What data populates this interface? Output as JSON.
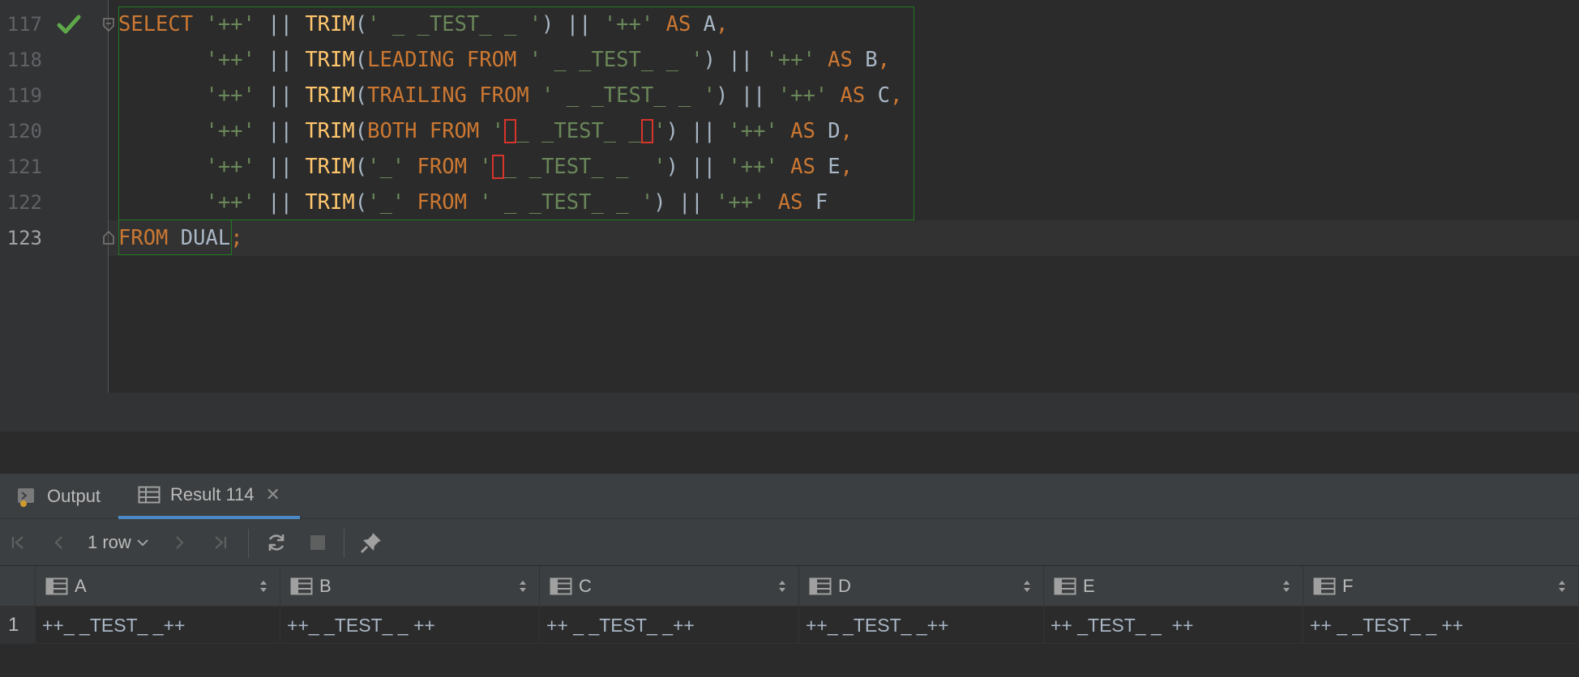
{
  "editor": {
    "line_numbers": [
      "117",
      "118",
      "119",
      "120",
      "121",
      "122",
      "123"
    ],
    "lines": [
      [
        {
          "t": "SELECT",
          "c": "kw"
        },
        {
          "t": " ",
          "c": ""
        },
        {
          "t": "'++'",
          "c": "str"
        },
        {
          "t": " || ",
          "c": ""
        },
        {
          "t": "TRIM",
          "c": "fn"
        },
        {
          "t": "(",
          "c": ""
        },
        {
          "t": "' _ _TEST_ _ '",
          "c": "str"
        },
        {
          "t": ") || ",
          "c": ""
        },
        {
          "t": "'++'",
          "c": "str"
        },
        {
          "t": " ",
          "c": ""
        },
        {
          "t": "AS",
          "c": "kw"
        },
        {
          "t": " A",
          "c": ""
        },
        {
          "t": ",",
          "c": "kw"
        }
      ],
      [
        {
          "t": "       ",
          "c": ""
        },
        {
          "t": "'++'",
          "c": "str"
        },
        {
          "t": " || ",
          "c": ""
        },
        {
          "t": "TRIM",
          "c": "fn"
        },
        {
          "t": "(",
          "c": ""
        },
        {
          "t": "LEADING FROM",
          "c": "kw"
        },
        {
          "t": " ",
          "c": ""
        },
        {
          "t": "' _ _TEST_ _ '",
          "c": "str"
        },
        {
          "t": ") || ",
          "c": ""
        },
        {
          "t": "'++'",
          "c": "str"
        },
        {
          "t": " ",
          "c": ""
        },
        {
          "t": "AS",
          "c": "kw"
        },
        {
          "t": " B",
          "c": ""
        },
        {
          "t": ",",
          "c": "kw"
        }
      ],
      [
        {
          "t": "       ",
          "c": ""
        },
        {
          "t": "'++'",
          "c": "str"
        },
        {
          "t": " || ",
          "c": ""
        },
        {
          "t": "TRIM",
          "c": "fn"
        },
        {
          "t": "(",
          "c": ""
        },
        {
          "t": "TRAILING FROM",
          "c": "kw"
        },
        {
          "t": " ",
          "c": ""
        },
        {
          "t": "' _ _TEST_ _ '",
          "c": "str"
        },
        {
          "t": ") || ",
          "c": ""
        },
        {
          "t": "'++'",
          "c": "str"
        },
        {
          "t": " ",
          "c": ""
        },
        {
          "t": "AS",
          "c": "kw"
        },
        {
          "t": " C",
          "c": ""
        },
        {
          "t": ",",
          "c": "kw"
        }
      ],
      [
        {
          "t": "       ",
          "c": ""
        },
        {
          "t": "'++'",
          "c": "str"
        },
        {
          "t": " || ",
          "c": ""
        },
        {
          "t": "TRIM",
          "c": "fn"
        },
        {
          "t": "(",
          "c": ""
        },
        {
          "t": "BOTH FROM",
          "c": "kw"
        },
        {
          "t": " ",
          "c": ""
        },
        {
          "t": "'",
          "c": "str"
        },
        {
          "t": " ",
          "c": "str hl"
        },
        {
          "t": "_ _TEST_ _",
          "c": "str"
        },
        {
          "t": " ",
          "c": "str hl"
        },
        {
          "t": "'",
          "c": "str"
        },
        {
          "t": ") || ",
          "c": ""
        },
        {
          "t": "'++'",
          "c": "str"
        },
        {
          "t": " ",
          "c": ""
        },
        {
          "t": "AS",
          "c": "kw"
        },
        {
          "t": " D",
          "c": ""
        },
        {
          "t": ",",
          "c": "kw"
        }
      ],
      [
        {
          "t": "       ",
          "c": ""
        },
        {
          "t": "'++'",
          "c": "str"
        },
        {
          "t": " || ",
          "c": ""
        },
        {
          "t": "TRIM",
          "c": "fn"
        },
        {
          "t": "(",
          "c": ""
        },
        {
          "t": "'_'",
          "c": "str"
        },
        {
          "t": " ",
          "c": ""
        },
        {
          "t": "FROM",
          "c": "kw"
        },
        {
          "t": " ",
          "c": ""
        },
        {
          "t": "'",
          "c": "str"
        },
        {
          "t": " ",
          "c": "str hl"
        },
        {
          "t": "_ _TEST_ _  '",
          "c": "str"
        },
        {
          "t": ") || ",
          "c": ""
        },
        {
          "t": "'++'",
          "c": "str"
        },
        {
          "t": " ",
          "c": ""
        },
        {
          "t": "AS",
          "c": "kw"
        },
        {
          "t": " E",
          "c": ""
        },
        {
          "t": ",",
          "c": "kw"
        }
      ],
      [
        {
          "t": "       ",
          "c": ""
        },
        {
          "t": "'++'",
          "c": "str"
        },
        {
          "t": " || ",
          "c": ""
        },
        {
          "t": "TRIM",
          "c": "fn"
        },
        {
          "t": "(",
          "c": ""
        },
        {
          "t": "'_'",
          "c": "str"
        },
        {
          "t": " ",
          "c": ""
        },
        {
          "t": "FROM",
          "c": "kw"
        },
        {
          "t": " ",
          "c": ""
        },
        {
          "t": "' _ _TEST_ _ '",
          "c": "str"
        },
        {
          "t": ") || ",
          "c": ""
        },
        {
          "t": "'++'",
          "c": "str"
        },
        {
          "t": " ",
          "c": ""
        },
        {
          "t": "AS",
          "c": "kw"
        },
        {
          "t": " F",
          "c": ""
        }
      ],
      [
        {
          "t": "FROM",
          "c": "kw"
        },
        {
          "t": " DUAL",
          "c": ""
        },
        {
          "t": ";",
          "c": "kw"
        }
      ]
    ]
  },
  "tool_window": {
    "tab_output": "Output",
    "tab_result": "Result 114",
    "tab_close": "✕"
  },
  "toolbar": {
    "rows_label": "1 row"
  },
  "result": {
    "columns": [
      "A",
      "B",
      "C",
      "D",
      "E",
      "F"
    ],
    "row_number": "1",
    "values": [
      "++_ _TEST_ _++",
      "++_ _TEST_ _ ++",
      "++ _ _TEST_ _++",
      "++_ _TEST_ _++",
      "++ _TEST_ _  ++",
      "++ _ _TEST_ _ ++"
    ]
  },
  "colors": {
    "keyword": "#cc7832",
    "function": "#ffc66d",
    "string": "#6a8759",
    "highlight": "#d7352b",
    "statement_border": "#1f7a1f"
  }
}
